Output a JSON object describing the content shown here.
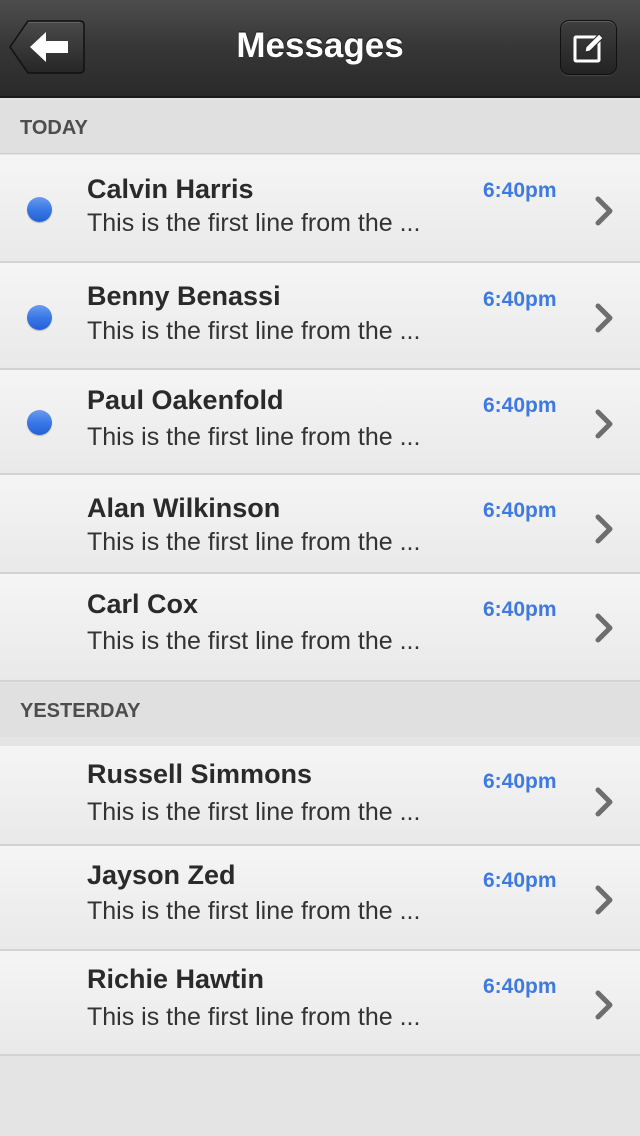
{
  "navbar": {
    "title": "Messages",
    "back_icon": "back-arrow-icon",
    "compose_icon": "compose-icon"
  },
  "sections": {
    "today": "TODAY",
    "yesterday": "YESTERDAY"
  },
  "today_messages": [
    {
      "name": "Calvin Harris",
      "preview": "This is the first line from the ...",
      "time": "6:40pm",
      "unread": true
    },
    {
      "name": "Benny Benassi",
      "preview": "This is the first line from the ...",
      "time": "6:40pm",
      "unread": true
    },
    {
      "name": "Paul Oakenfold",
      "preview": "This is the first line from the ...",
      "time": "6:40pm",
      "unread": true
    },
    {
      "name": "Alan Wilkinson",
      "preview": "This is the first line from the ...",
      "time": "6:40pm",
      "unread": false
    },
    {
      "name": "Carl Cox",
      "preview": "This is the first line from the ...",
      "time": "6:40pm",
      "unread": false
    }
  ],
  "yesterday_messages": [
    {
      "name": "Russell Simmons",
      "preview": "This is the first line from the ...",
      "time": "6:40pm",
      "unread": false
    },
    {
      "name": "Jayson Zed",
      "preview": "This is the first line from the ...",
      "time": "6:40pm",
      "unread": false
    },
    {
      "name": "Richie Hawtin",
      "preview": "This is the first line from the ...",
      "time": "6:40pm",
      "unread": false
    }
  ],
  "colors": {
    "accent": "#3e7ae0",
    "unread_dot": "#3a78e6",
    "navbar": "#363636"
  }
}
